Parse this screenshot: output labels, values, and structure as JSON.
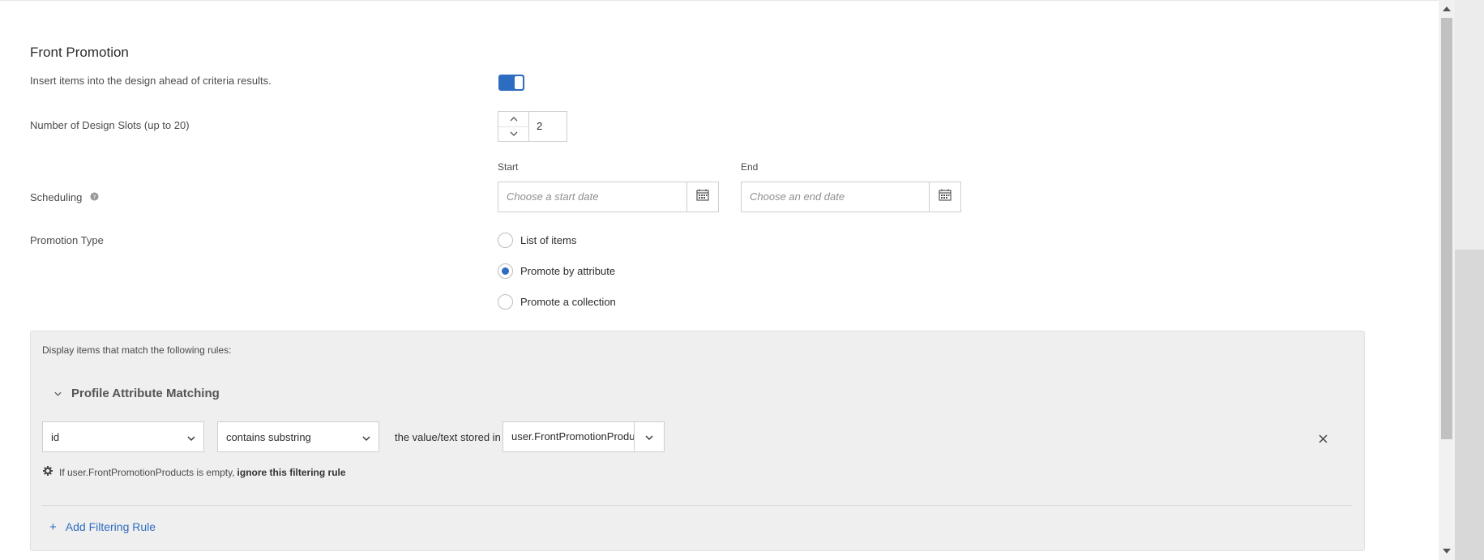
{
  "section": {
    "title": "Front Promotion"
  },
  "front_promotion": {
    "label": "Insert items into the design ahead of criteria results.",
    "enabled": true
  },
  "design_slots": {
    "label": "Number of Design Slots (up to 20)",
    "value": "2"
  },
  "scheduling": {
    "label": "Scheduling",
    "start_label": "Start",
    "end_label": "End",
    "start_placeholder": "Choose a start date",
    "end_placeholder": "Choose an end date"
  },
  "promotion_type": {
    "label": "Promotion Type",
    "options": [
      {
        "label": "List of items",
        "selected": false
      },
      {
        "label": "Promote by attribute",
        "selected": true
      },
      {
        "label": "Promote a collection",
        "selected": false
      }
    ]
  },
  "rules": {
    "intro": "Display items that match the following rules:",
    "group_title": "Profile Attribute Matching",
    "attribute": "id",
    "operator": "contains substring",
    "connector": "the value/text stored in",
    "source": "user.FrontPromotionProdu",
    "empty_prefix": "If user.FrontPromotionProducts is empty,",
    "empty_action": "ignore this filtering rule",
    "add_label": "Add Filtering Rule"
  },
  "colors": {
    "accent": "#2d6cc0",
    "panel": "#efefef"
  },
  "icons": [
    "help-icon",
    "calendar-icon",
    "chevron-up-icon",
    "chevron-down-icon",
    "close-icon",
    "gear-icon",
    "plus-icon"
  ]
}
